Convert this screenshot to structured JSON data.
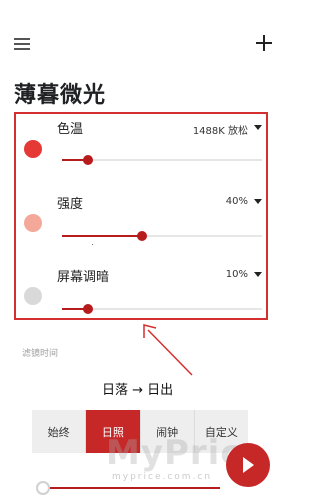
{
  "app": {
    "title": "薄暮微光"
  },
  "icons": {
    "menu": "hamburger-menu-icon",
    "add": "plus-icon",
    "play": "play-icon"
  },
  "colors": {
    "accent": "#c62828",
    "color_temperature_dot": "#e53935",
    "intensity_dot": "#f4a89a",
    "screen_dim_dot": "#d9d9d9",
    "annotation": "#d32f2f"
  },
  "settings": {
    "color_temperature": {
      "label": "色温",
      "value": "1488K 放松",
      "level": 0.13
    },
    "intensity": {
      "label": "强度",
      "value": "40%",
      "level": 0.4
    },
    "screen_dim": {
      "label": "屏幕调暗",
      "value": "10%",
      "level": 0.13
    }
  },
  "filter_time": {
    "label": "滤镜时间"
  },
  "annotation": {
    "caption": "日落 → 日出"
  },
  "schedule_tabs": [
    {
      "label": "始终",
      "active": false
    },
    {
      "label": "日照",
      "active": true
    },
    {
      "label": "闹钟",
      "active": false
    },
    {
      "label": "自定义",
      "active": false
    }
  ],
  "watermark": {
    "main": "MyPrice",
    "sub": "myprice.com.cn"
  }
}
